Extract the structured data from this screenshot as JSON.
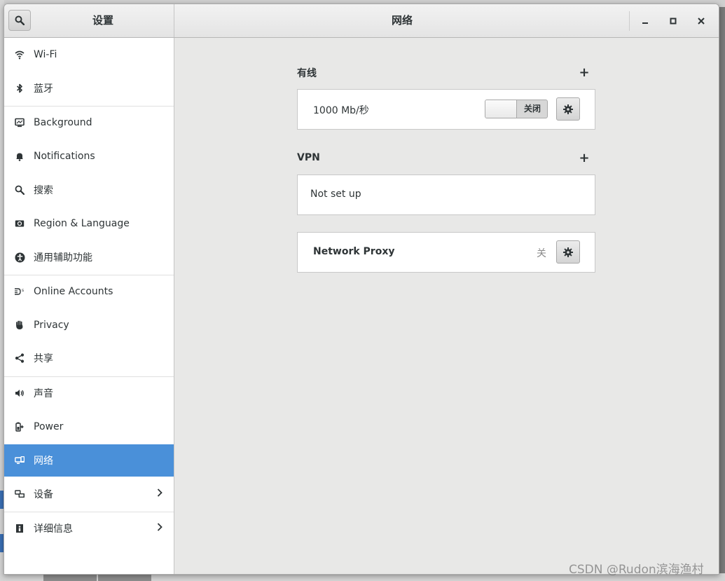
{
  "window": {
    "sidebar_title": "设置",
    "panel_title": "网络",
    "wm": {
      "minimize": "–",
      "maximize": "□",
      "close": "✕"
    }
  },
  "sidebar": {
    "items": [
      {
        "label": "Wi-Fi",
        "icon": "wifi-icon"
      },
      {
        "label": "蓝牙",
        "icon": "bluetooth-icon"
      },
      {
        "label": "Background",
        "icon": "background-icon"
      },
      {
        "label": "Notifications",
        "icon": "bell-icon"
      },
      {
        "label": "搜索",
        "icon": "search-icon"
      },
      {
        "label": "Region & Language",
        "icon": "region-icon"
      },
      {
        "label": "通用辅助功能",
        "icon": "accessibility-icon"
      },
      {
        "label": "Online Accounts",
        "icon": "online-accounts-icon"
      },
      {
        "label": "Privacy",
        "icon": "hand-icon"
      },
      {
        "label": "共享",
        "icon": "share-icon"
      },
      {
        "label": "声音",
        "icon": "speaker-icon"
      },
      {
        "label": "Power",
        "icon": "power-icon"
      },
      {
        "label": "网络",
        "icon": "network-icon",
        "active": true
      },
      {
        "label": "设备",
        "icon": "devices-icon",
        "has_submenu": true
      },
      {
        "label": "详细信息",
        "icon": "details-icon",
        "has_submenu": true
      }
    ]
  },
  "main": {
    "wired": {
      "title": "有线",
      "add": "+",
      "connection_label": "1000 Mb/秒",
      "toggle_state": "关闭"
    },
    "vpn": {
      "title": "VPN",
      "add": "+",
      "status": "Not set up"
    },
    "proxy": {
      "label": "Network Proxy",
      "status": "关"
    }
  },
  "watermark": "CSDN @Rudon滨海渔村",
  "colors": {
    "accent": "#4a90d9",
    "main_bg": "#e8e8e7",
    "header_bg": "#e8e8e8"
  }
}
